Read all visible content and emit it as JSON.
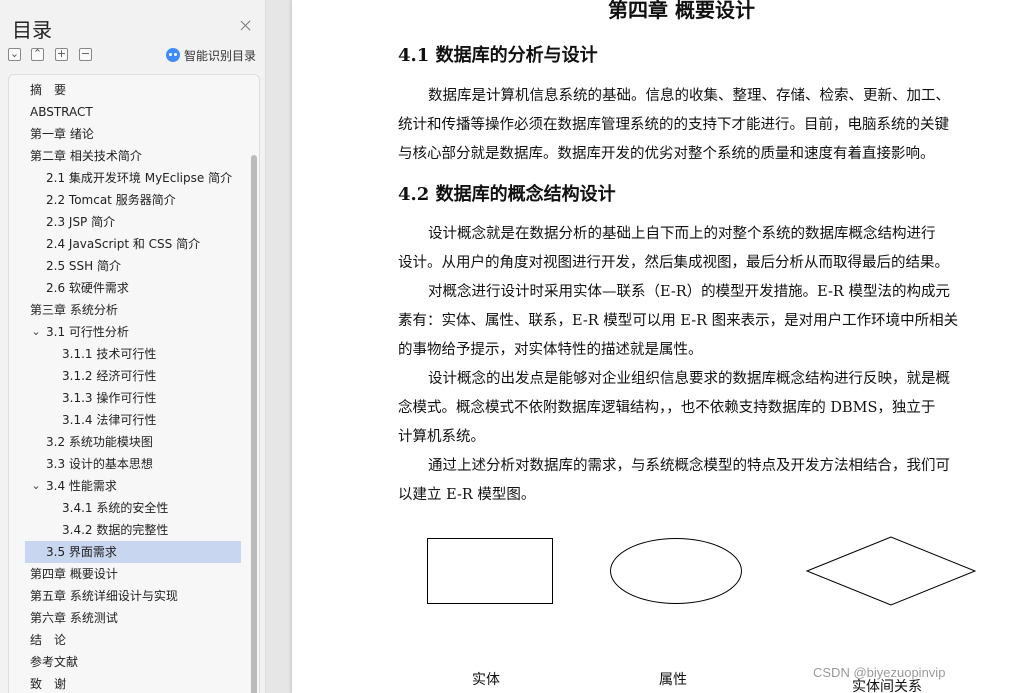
{
  "sidebar": {
    "title": "目录",
    "toolbar": {
      "collapse_all": "⌄",
      "expand_up": "⌃",
      "expand": "+",
      "shrink": "−"
    },
    "ai_toc_label": "智能识别目录",
    "icons": {
      "close": "close-icon",
      "ai": "ai-robot-icon"
    },
    "items": [
      {
        "label": "摘　要"
      },
      {
        "label": "ABSTRACT"
      },
      {
        "label": "第一章  绪论",
        "arrow": "›"
      },
      {
        "label": "第二章  相关技术简介",
        "arrow": "⌄"
      },
      {
        "label": "2.1 集成开发环境 MyEclipse 简介"
      },
      {
        "label": "2.2 Tomcat 服务器简介"
      },
      {
        "label": "2.3 JSP 简介"
      },
      {
        "label": "2.4 JavaScript 和 CSS 简介"
      },
      {
        "label": "2.5 SSH 简介"
      },
      {
        "label": "2.6 软硬件需求"
      },
      {
        "label": "第三章  系统分析",
        "arrow": "⌄"
      },
      {
        "label": "3.1 可行性分析",
        "arrow": "⌄"
      },
      {
        "label": "3.1.1 技术可行性"
      },
      {
        "label": "3.1.2 经济可行性"
      },
      {
        "label": "3.1.3 操作可行性"
      },
      {
        "label": "3.1.4 法律可行性"
      },
      {
        "label": "3.2 系统功能模块图"
      },
      {
        "label": "3.3 设计的基本思想"
      },
      {
        "label": "3.4 性能需求",
        "arrow": "⌄"
      },
      {
        "label": "3.4.1 系统的安全性"
      },
      {
        "label": "3.4.2 数据的完整性"
      },
      {
        "label": "3.5 界面需求",
        "selected": true
      },
      {
        "label": "第四章  概要设计",
        "arrow": "›"
      },
      {
        "label": "第五章  系统详细设计与实现",
        "arrow": "›"
      },
      {
        "label": "第六章  系统测试",
        "arrow": "›"
      },
      {
        "label": "结　论"
      },
      {
        "label": "参考文献"
      },
      {
        "label": "致　谢"
      }
    ]
  },
  "document": {
    "chapter_title": "第四章  概要设计",
    "s41_heading": "4.1 数据库的分析与设计",
    "s41_lines": [
      "数据库是计算机信息系统的基础。信息的收集、整理、存储、检索、更新、加工、",
      "统计和传播等操作必须在数据库管理系统的的支持下才能进行。目前，电脑系统的关键",
      "与核心部分就是数据库。数据库开发的优劣对整个系统的质量和速度有着直接影响。"
    ],
    "s42_heading": "4.2 数据库的概念结构设计",
    "s42_lines": [
      "设计概念就是在数据分析的基础上自下而上的对整个系统的数据库概念结构进行",
      "设计。从用户的角度对视图进行开发，然后集成视图，最后分析从而取得最后的结果。",
      "对概念进行设计时采用实体—联系（E-R）的模型开发措施。E-R 模型法的构成元",
      "素有：实体、属性、联系，E-R 模型可以用 E-R 图来表示，是对用户工作环境中所相关",
      "的事物给予提示，对实体特性的描述就是属性。",
      "设计概念的出发点是能够对企业组织信息要求的数据库概念结构进行反映，就是概",
      "念模式。概念模式不依附数据库逻辑结构，，也不依赖支持数据库的 DBMS，独立于",
      "计算机系统。",
      "通过上述分析对数据库的需求，与系统概念模型的特点及开发方法相结合，我们可",
      "以建立 E-R 模型图。"
    ],
    "figure": {
      "captions": [
        "实体",
        "属性",
        "实体间关系"
      ]
    }
  },
  "watermark": "CSDN @biyezuopinvip"
}
